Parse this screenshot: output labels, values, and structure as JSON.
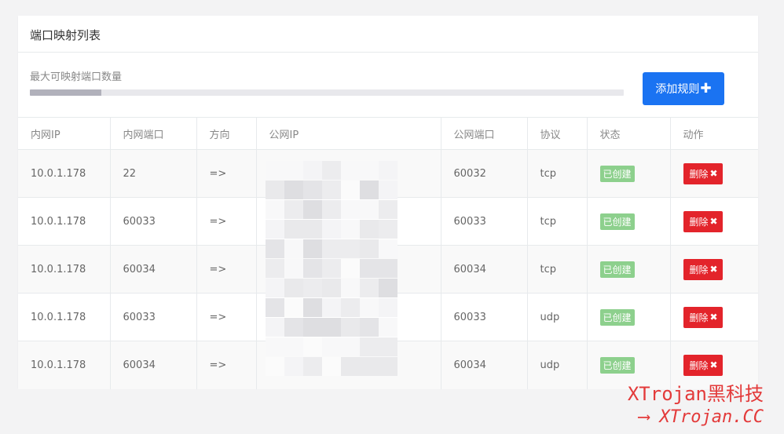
{
  "panel": {
    "title": "端口映射列表",
    "quota_label": "最大可映射端口数量",
    "quota_fraction": 0.12,
    "add_button_label": "添加规则",
    "add_button_icon": "plus-icon"
  },
  "table": {
    "headers": [
      "内网IP",
      "内网端口",
      "方向",
      "公网IP",
      "公网端口",
      "协议",
      "状态",
      "动作"
    ],
    "rows": [
      {
        "lan_ip": "10.0.1.178",
        "lan_port": "22",
        "direction": "=>",
        "public_ip": "",
        "public_port": "60032",
        "protocol": "tcp",
        "status": "已创建",
        "action": "删除"
      },
      {
        "lan_ip": "10.0.1.178",
        "lan_port": "60033",
        "direction": "=>",
        "public_ip": "",
        "public_port": "60033",
        "protocol": "tcp",
        "status": "已创建",
        "action": "删除"
      },
      {
        "lan_ip": "10.0.1.178",
        "lan_port": "60034",
        "direction": "=>",
        "public_ip": "",
        "public_port": "60034",
        "protocol": "tcp",
        "status": "已创建",
        "action": "删除"
      },
      {
        "lan_ip": "10.0.1.178",
        "lan_port": "60033",
        "direction": "=>",
        "public_ip": "",
        "public_port": "60033",
        "protocol": "udp",
        "status": "已创建",
        "action": "删除"
      },
      {
        "lan_ip": "10.0.1.178",
        "lan_port": "60034",
        "direction": "=>",
        "public_ip": "",
        "public_port": "60034",
        "protocol": "udp",
        "status": "已创建",
        "action": "删除"
      }
    ]
  },
  "watermark": {
    "line1": "XTrojan黑科技",
    "line2": "XTrojan.CC"
  },
  "colors": {
    "accent_blue": "#1a73f2",
    "danger_red": "#e3242b",
    "status_green": "#8dd08d"
  }
}
